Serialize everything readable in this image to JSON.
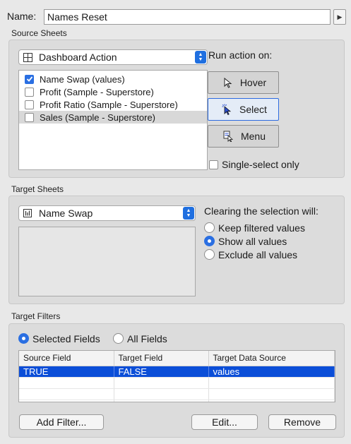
{
  "name": {
    "label": "Name:",
    "value": "Names Reset"
  },
  "source": {
    "section_title": "Source Sheets",
    "dropdown": {
      "value": "Dashboard Action",
      "icon": "dashboard-icon"
    },
    "sheets": [
      {
        "label": "Name Swap (values)",
        "checked": true
      },
      {
        "label": "Profit (Sample - Superstore)",
        "checked": false
      },
      {
        "label": "Profit Ratio (Sample - Superstore)",
        "checked": false
      },
      {
        "label": "Sales (Sample - Superstore)",
        "checked": false
      }
    ],
    "run_on": {
      "label": "Run action on:",
      "hover": "Hover",
      "select": "Select",
      "menu": "Menu",
      "single_select": "Single-select only"
    }
  },
  "target": {
    "section_title": "Target Sheets",
    "dropdown": {
      "value": "Name Swap",
      "icon": "worksheet-icon"
    },
    "clearing": {
      "label": "Clearing the selection will:",
      "options": [
        "Keep filtered values",
        "Show all values",
        "Exclude all values"
      ],
      "selected": 1
    }
  },
  "filters": {
    "section_title": "Target Filters",
    "selected_fields": "Selected Fields",
    "all_fields": "All Fields",
    "columns": [
      "Source Field",
      "Target Field",
      "Target Data Source"
    ],
    "rows": [
      [
        "TRUE",
        "FALSE",
        "values"
      ]
    ],
    "add_filter": "Add Filter...",
    "edit": "Edit...",
    "remove": "Remove"
  },
  "colors": {
    "accent": "#2a6fe2",
    "selection": "#0b4ed8"
  }
}
